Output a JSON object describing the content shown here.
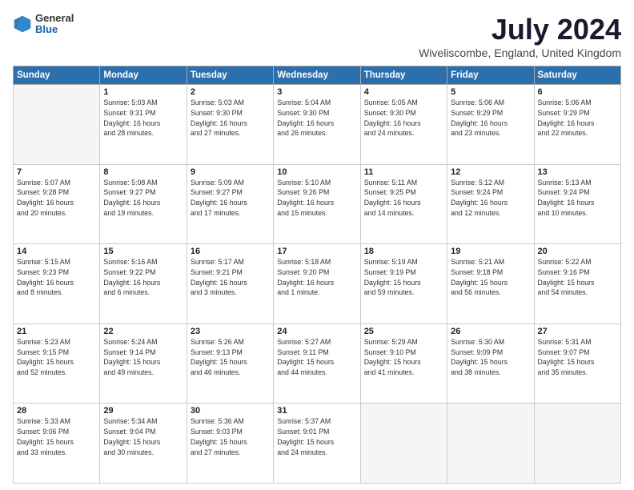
{
  "header": {
    "logo_general": "General",
    "logo_blue": "Blue",
    "month_year": "July 2024",
    "location": "Wiveliscombe, England, United Kingdom"
  },
  "weekdays": [
    "Sunday",
    "Monday",
    "Tuesday",
    "Wednesday",
    "Thursday",
    "Friday",
    "Saturday"
  ],
  "weeks": [
    [
      {
        "day": "",
        "info": ""
      },
      {
        "day": "1",
        "info": "Sunrise: 5:03 AM\nSunset: 9:31 PM\nDaylight: 16 hours\nand 28 minutes."
      },
      {
        "day": "2",
        "info": "Sunrise: 5:03 AM\nSunset: 9:30 PM\nDaylight: 16 hours\nand 27 minutes."
      },
      {
        "day": "3",
        "info": "Sunrise: 5:04 AM\nSunset: 9:30 PM\nDaylight: 16 hours\nand 26 minutes."
      },
      {
        "day": "4",
        "info": "Sunrise: 5:05 AM\nSunset: 9:30 PM\nDaylight: 16 hours\nand 24 minutes."
      },
      {
        "day": "5",
        "info": "Sunrise: 5:06 AM\nSunset: 9:29 PM\nDaylight: 16 hours\nand 23 minutes."
      },
      {
        "day": "6",
        "info": "Sunrise: 5:06 AM\nSunset: 9:29 PM\nDaylight: 16 hours\nand 22 minutes."
      }
    ],
    [
      {
        "day": "7",
        "info": "Sunrise: 5:07 AM\nSunset: 9:28 PM\nDaylight: 16 hours\nand 20 minutes."
      },
      {
        "day": "8",
        "info": "Sunrise: 5:08 AM\nSunset: 9:27 PM\nDaylight: 16 hours\nand 19 minutes."
      },
      {
        "day": "9",
        "info": "Sunrise: 5:09 AM\nSunset: 9:27 PM\nDaylight: 16 hours\nand 17 minutes."
      },
      {
        "day": "10",
        "info": "Sunrise: 5:10 AM\nSunset: 9:26 PM\nDaylight: 16 hours\nand 15 minutes."
      },
      {
        "day": "11",
        "info": "Sunrise: 5:11 AM\nSunset: 9:25 PM\nDaylight: 16 hours\nand 14 minutes."
      },
      {
        "day": "12",
        "info": "Sunrise: 5:12 AM\nSunset: 9:24 PM\nDaylight: 16 hours\nand 12 minutes."
      },
      {
        "day": "13",
        "info": "Sunrise: 5:13 AM\nSunset: 9:24 PM\nDaylight: 16 hours\nand 10 minutes."
      }
    ],
    [
      {
        "day": "14",
        "info": "Sunrise: 5:15 AM\nSunset: 9:23 PM\nDaylight: 16 hours\nand 8 minutes."
      },
      {
        "day": "15",
        "info": "Sunrise: 5:16 AM\nSunset: 9:22 PM\nDaylight: 16 hours\nand 6 minutes."
      },
      {
        "day": "16",
        "info": "Sunrise: 5:17 AM\nSunset: 9:21 PM\nDaylight: 16 hours\nand 3 minutes."
      },
      {
        "day": "17",
        "info": "Sunrise: 5:18 AM\nSunset: 9:20 PM\nDaylight: 16 hours\nand 1 minute."
      },
      {
        "day": "18",
        "info": "Sunrise: 5:19 AM\nSunset: 9:19 PM\nDaylight: 15 hours\nand 59 minutes."
      },
      {
        "day": "19",
        "info": "Sunrise: 5:21 AM\nSunset: 9:18 PM\nDaylight: 15 hours\nand 56 minutes."
      },
      {
        "day": "20",
        "info": "Sunrise: 5:22 AM\nSunset: 9:16 PM\nDaylight: 15 hours\nand 54 minutes."
      }
    ],
    [
      {
        "day": "21",
        "info": "Sunrise: 5:23 AM\nSunset: 9:15 PM\nDaylight: 15 hours\nand 52 minutes."
      },
      {
        "day": "22",
        "info": "Sunrise: 5:24 AM\nSunset: 9:14 PM\nDaylight: 15 hours\nand 49 minutes."
      },
      {
        "day": "23",
        "info": "Sunrise: 5:26 AM\nSunset: 9:13 PM\nDaylight: 15 hours\nand 46 minutes."
      },
      {
        "day": "24",
        "info": "Sunrise: 5:27 AM\nSunset: 9:11 PM\nDaylight: 15 hours\nand 44 minutes."
      },
      {
        "day": "25",
        "info": "Sunrise: 5:29 AM\nSunset: 9:10 PM\nDaylight: 15 hours\nand 41 minutes."
      },
      {
        "day": "26",
        "info": "Sunrise: 5:30 AM\nSunset: 9:09 PM\nDaylight: 15 hours\nand 38 minutes."
      },
      {
        "day": "27",
        "info": "Sunrise: 5:31 AM\nSunset: 9:07 PM\nDaylight: 15 hours\nand 35 minutes."
      }
    ],
    [
      {
        "day": "28",
        "info": "Sunrise: 5:33 AM\nSunset: 9:06 PM\nDaylight: 15 hours\nand 33 minutes."
      },
      {
        "day": "29",
        "info": "Sunrise: 5:34 AM\nSunset: 9:04 PM\nDaylight: 15 hours\nand 30 minutes."
      },
      {
        "day": "30",
        "info": "Sunrise: 5:36 AM\nSunset: 9:03 PM\nDaylight: 15 hours\nand 27 minutes."
      },
      {
        "day": "31",
        "info": "Sunrise: 5:37 AM\nSunset: 9:01 PM\nDaylight: 15 hours\nand 24 minutes."
      },
      {
        "day": "",
        "info": ""
      },
      {
        "day": "",
        "info": ""
      },
      {
        "day": "",
        "info": ""
      }
    ]
  ]
}
